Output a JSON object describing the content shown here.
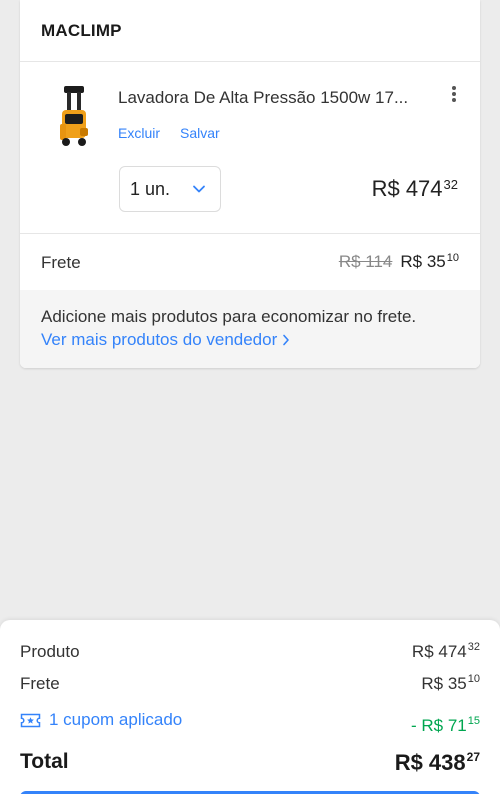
{
  "seller": {
    "name": "MACLIMP"
  },
  "item": {
    "title": "Lavadora De Alta Pressão 1500w 17...",
    "thumb_icon": "pressure-washer-image",
    "actions": {
      "delete": "Excluir",
      "save": "Salvar"
    },
    "quantity": "1 un.",
    "price": {
      "integer": "R$ 474",
      "cents": "32"
    }
  },
  "shipping": {
    "label": "Frete",
    "old_price": "R$ 114",
    "new_price": {
      "integer": "R$ 35",
      "cents": "10"
    }
  },
  "promo": {
    "text": "Adicione mais produtos para economizar no frete.",
    "link": "Ver mais produtos do vendedor"
  },
  "summary": {
    "product": {
      "label": "Produto",
      "integer": "R$ 474",
      "cents": "32"
    },
    "shipping": {
      "label": "Frete",
      "integer": "R$ 35",
      "cents": "10"
    },
    "coupon": {
      "label": "1 cupom aplicado",
      "integer": "- R$ 71",
      "cents": "15"
    },
    "total": {
      "label": "Total",
      "integer": "R$ 438",
      "cents": "27"
    }
  },
  "colors": {
    "link": "#3483fa",
    "discount": "#00a650",
    "background": "#ececec"
  }
}
